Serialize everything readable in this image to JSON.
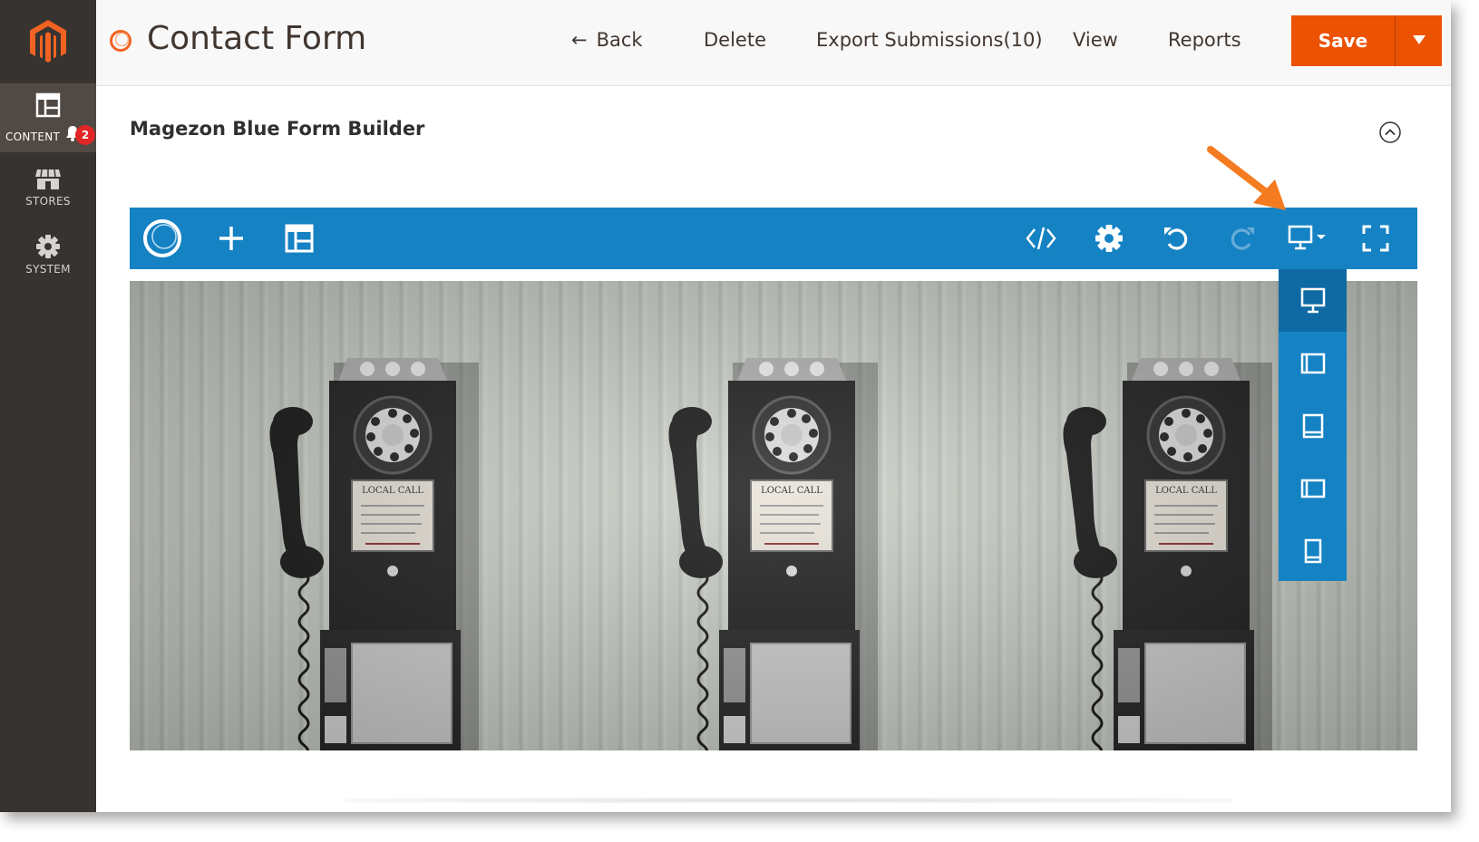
{
  "sidebar": {
    "items": [
      {
        "label": "CONTENT",
        "icon": "content-icon",
        "active": true,
        "badge": "2"
      },
      {
        "label": "STORES",
        "icon": "stores-icon",
        "active": false
      },
      {
        "label": "SYSTEM",
        "icon": "gear-icon",
        "active": false
      }
    ]
  },
  "header": {
    "title": "Contact Form",
    "back_label": "Back",
    "delete_label": "Delete",
    "export_label": "Export Submissions(10)",
    "view_label": "View",
    "reports_label": "Reports",
    "save_label": "Save"
  },
  "section": {
    "title": "Magezon Blue Form Builder"
  },
  "toolbar": {
    "left_icons": [
      "magezon-logo-icon",
      "plus-icon",
      "layout-icon"
    ],
    "right_icons": [
      "code-icon",
      "gear-icon",
      "undo-icon",
      "redo-icon",
      "desktop-icon",
      "fullscreen-icon"
    ]
  },
  "device_menu": {
    "items": [
      "desktop-icon",
      "tablet-landscape-icon",
      "tablet-portrait-icon",
      "mobile-landscape-icon",
      "mobile-portrait-icon"
    ],
    "active_index": 0
  },
  "colors": {
    "sidebar": "#373330",
    "accent": "#eb5202",
    "toolbar": "#1582c4",
    "badge": "#e22626"
  },
  "phones": {
    "labels": [
      "LOCAL CALL",
      "LOCAL CALL",
      "LOCAL CALL"
    ]
  }
}
